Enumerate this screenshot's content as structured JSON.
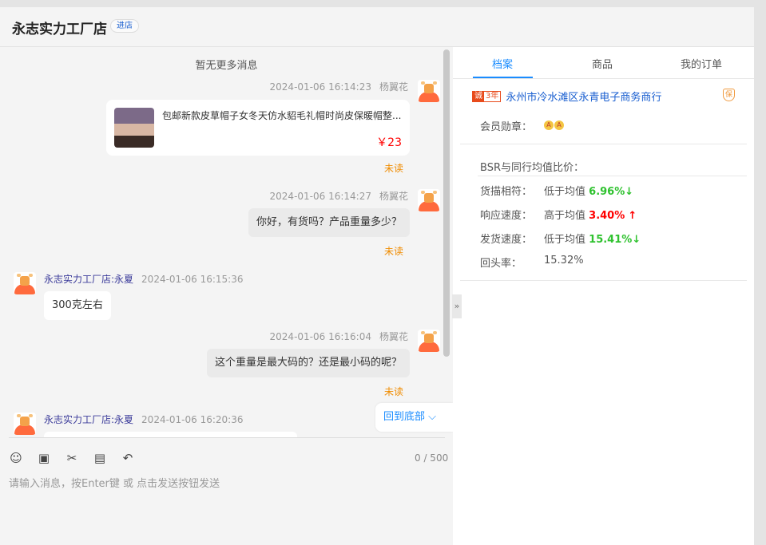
{
  "header": {
    "title": "永志实力工厂店",
    "enter_store": "进店"
  },
  "chat": {
    "no_more": "暂无更多消息",
    "messages": [
      {
        "time": "2024-01-06 16:14:23",
        "sender": "杨翼花",
        "type": "product",
        "product_title": "包邮新款皮草帽子女冬天仿水貂毛礼帽时尚皮保暖帽整...",
        "price": "￥23",
        "status": "未读"
      },
      {
        "time": "2024-01-06 16:14:27",
        "sender": "杨翼花",
        "text": "你好，有货吗？产品重量多少？",
        "status": "未读"
      },
      {
        "time": "2024-01-06 16:15:36",
        "sender": "永志实力工厂店:永夏",
        "text": "300克左右"
      },
      {
        "time": "2024-01-06 16:16:04",
        "sender": "杨翼花",
        "text": "这个重量是最大码的？还是最小码的呢？",
        "status": "未读"
      },
      {
        "time": "2024-01-06 16:20:36",
        "sender": "永志实力工厂店:永夏"
      }
    ],
    "back_to_bottom": "回到底部",
    "char_count": "0 / 500",
    "input_placeholder": "请输入消息，按Enter键 或 点击发送按钮发送"
  },
  "right": {
    "tabs": [
      "档案",
      "商品",
      "我的订单"
    ],
    "shop_badge_years": "3年",
    "shop_badge_icon": "诚",
    "shop_name": "永州市冷水滩区永青电子商务商行",
    "guarantee": "保",
    "medal_label": "会员勋章：",
    "medals": [
      "A",
      "A"
    ],
    "bsr_title": "BSR与同行均值比价：",
    "metrics": [
      {
        "label": "货描相符：",
        "desc": "低于均值",
        "value": "6.96%",
        "arrow": "↓"
      },
      {
        "label": "响应速度：",
        "desc": "高于均值",
        "value": "3.40%",
        "arrow": "↑"
      },
      {
        "label": "发货速度：",
        "desc": "低于均值",
        "value": "15.41%",
        "arrow": "↓"
      }
    ],
    "repeat_label": "回头率：",
    "repeat_value": "15.32%"
  }
}
